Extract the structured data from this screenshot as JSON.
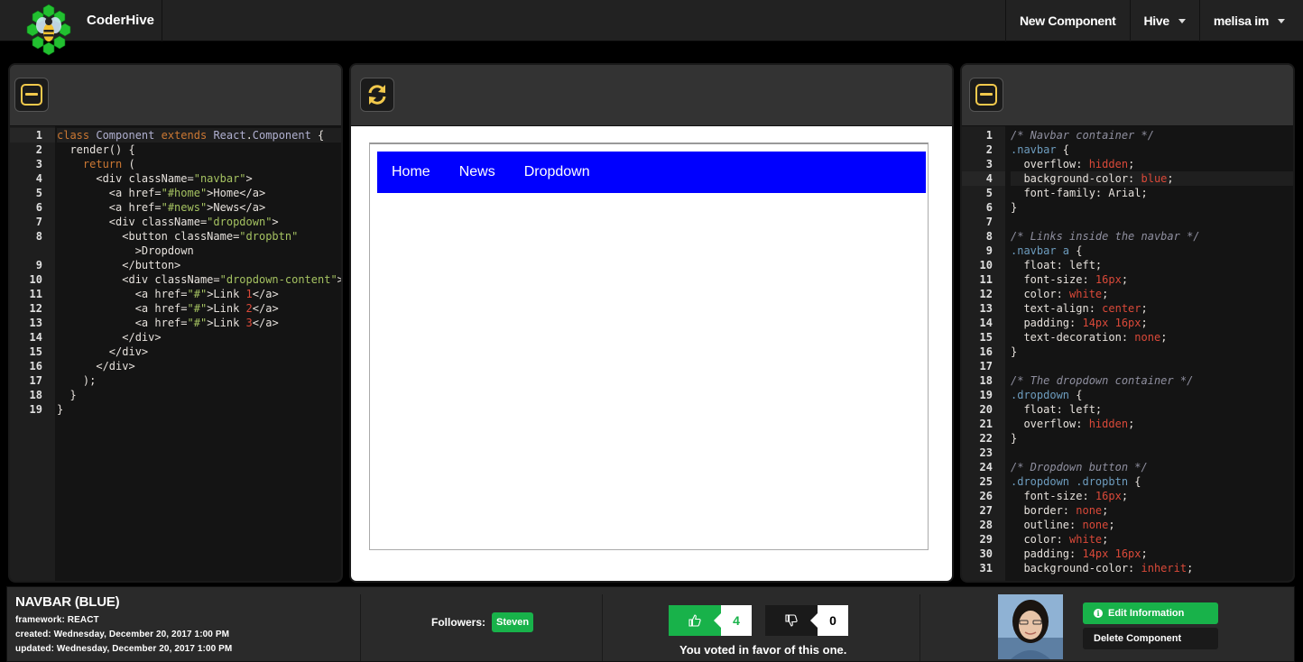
{
  "app": {
    "brand": "CoderHive"
  },
  "nav": {
    "new_component": "New Component",
    "hive": "Hive",
    "user": "melisa im"
  },
  "js_editor": {
    "line_numbers": [
      "1",
      "2",
      "3",
      "4",
      "5",
      "6",
      "7",
      "8",
      "",
      "9",
      "10",
      "11",
      "12",
      "13",
      "14",
      "15",
      "16",
      "17",
      "18",
      "19"
    ]
  },
  "css_editor": {
    "line_numbers": [
      "1",
      "2",
      "3",
      "4",
      "5",
      "6",
      "7",
      "8",
      "9",
      "10",
      "11",
      "12",
      "13",
      "14",
      "15",
      "16",
      "17",
      "18",
      "19",
      "20",
      "21",
      "22",
      "23",
      "24",
      "25",
      "26",
      "27",
      "28",
      "29",
      "30",
      "31"
    ]
  },
  "preview": {
    "links": [
      "Home",
      "News",
      "Dropdown"
    ]
  },
  "footer": {
    "component_title": "NAVBAR (BLUE)",
    "framework_label": "framework:",
    "framework_value": "REACT",
    "created_label": "created:",
    "created_value": "Wednesday, December 20, 2017 1:00 PM",
    "updated_label": "updated:",
    "updated_value": "Wednesday, December 20, 2017 1:00 PM",
    "followers_label": "Followers:",
    "follower_name": "Steven",
    "upvotes": "4",
    "downvotes": "0",
    "vote_message": "You voted in favor of this one.",
    "edit_button": "Edit Information",
    "delete_button": "Delete Component"
  },
  "colors": {
    "accent_green": "#18b24a",
    "icon_yellow": "#f2c94c",
    "navbar_blue": "#0000ff"
  }
}
